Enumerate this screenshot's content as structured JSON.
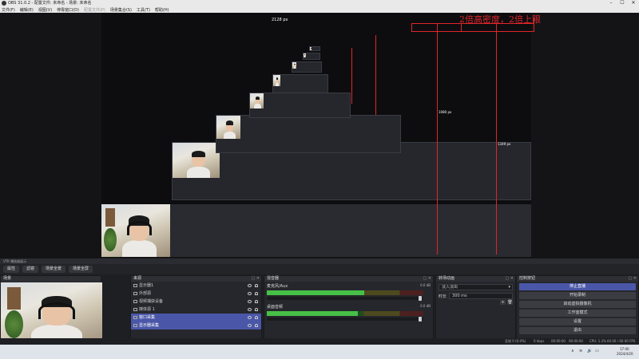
{
  "window": {
    "title": "OBS 31.0.2 - 配置文件: 未命名 - 场景: 未命名"
  },
  "menu": [
    "文件(F)",
    "编辑(E)",
    "视图(V)",
    "停靠窗口(D)",
    "配置文件(P)",
    "场景集合(S)",
    "工具(T)",
    "帮助(H)"
  ],
  "menu_disabled_index": 4,
  "annotation": {
    "heading": "2倍高密度，2倍上限",
    "width_label": "2128 px",
    "height_label_small": "1080 px",
    "height_label_large": "1349 px",
    "color": "#e0262a"
  },
  "context": {
    "text": "VTK 播放器展示"
  },
  "source_toolbar": [
    "属性",
    "滤镜",
    "场景全景",
    "场景全屏"
  ],
  "scenes_dock": {
    "title": "场景"
  },
  "sources_dock": {
    "title": "来源",
    "items": [
      {
        "label": "显示器1",
        "selected": false
      },
      {
        "label": "外部源",
        "selected": false
      },
      {
        "label": "视频捕获设备",
        "selected": false
      },
      {
        "label": "媒体源 1",
        "selected": false
      },
      {
        "label": "窗口采集",
        "selected": true
      },
      {
        "label": "显示器采集",
        "selected": true
      }
    ]
  },
  "mixer_dock": {
    "title": "混音器",
    "channels": [
      {
        "name": "麦克风/Aux",
        "db": "0.0 dB",
        "level": 0.62,
        "fader": 0.99
      },
      {
        "name": "桌面音频",
        "db": "0.0 dB",
        "level": 0.58,
        "fader": 0.99
      }
    ]
  },
  "transitions_dock": {
    "title": "转场动画",
    "transition": "淡入淡出",
    "duration_label": "时长",
    "duration": "300 ms"
  },
  "controls_dock": {
    "title": "控制按钮",
    "buttons": [
      "停止直播",
      "开始录制",
      "启动虚拟摄像机",
      "工作室模式",
      "设置",
      "退出"
    ]
  },
  "status": {
    "dropped": "丢帧 0 (0.0%)",
    "bitrate": "0 kbps",
    "live": "00:00:00",
    "rec": "00:00:00",
    "cpu": "CPU: 1.2%",
    "fps": "60.00 / 60.00 FPS"
  },
  "taskbar": {
    "time": "17:00",
    "date": "2024/4/20"
  }
}
